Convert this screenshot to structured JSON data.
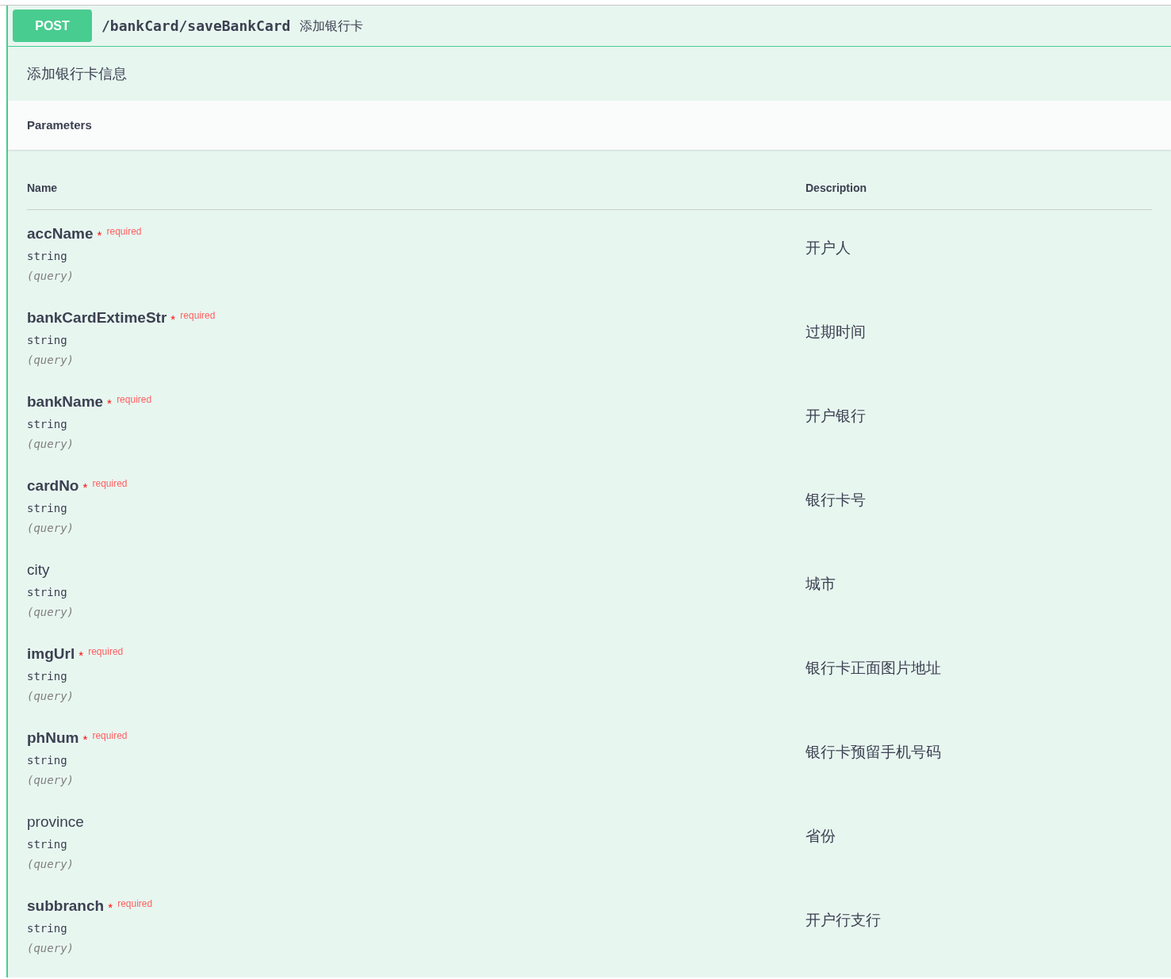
{
  "operation": {
    "method": "POST",
    "path": "/bankCard/saveBankCard",
    "summary": "添加银行卡"
  },
  "description": "添加银行卡信息",
  "parameters_title": "Parameters",
  "table": {
    "columns": [
      "Name",
      "Description"
    ],
    "rows": [
      {
        "name": "accName",
        "required": true,
        "required_mark": "* $^{required}$",
        "type": "string",
        "in": "(query)",
        "description": "开户人"
      },
      {
        "name": "bankCardExtimeStr",
        "required": true,
        "required_mark": "* $^{required}$",
        "type": "string",
        "in": "(query)",
        "description": "过期时间"
      },
      {
        "name": "bankName",
        "required": true,
        "required_mark": "* $^{required}$",
        "type": "string",
        "in": "(query)",
        "description": "开户银行"
      },
      {
        "name": "cardNo",
        "required": true,
        "required_mark": "* $^{required}$",
        "type": "string",
        "in": "(query)",
        "description": "银行卡号"
      },
      {
        "name": "city",
        "required": false,
        "type": "string",
        "in": "(query)",
        "description": "城市"
      },
      {
        "name": "imgUrl",
        "required": true,
        "required_mark": "* $^{required}$",
        "type": "string",
        "in": "(query)",
        "description": "银行卡正面图片地址"
      },
      {
        "name": "phNum",
        "required": true,
        "required_mark": "* $^{required}$",
        "type": "string",
        "in": "(query)",
        "description": "银行卡预留手机号码"
      },
      {
        "name": "province",
        "required": false,
        "type": "string",
        "in": "(query)",
        "description": "省份"
      },
      {
        "name": "subbranch",
        "required": true,
        "required_mark": "* $^{required}$",
        "type": "string",
        "in": "(query)",
        "description": "开户行支行"
      }
    ]
  }
}
